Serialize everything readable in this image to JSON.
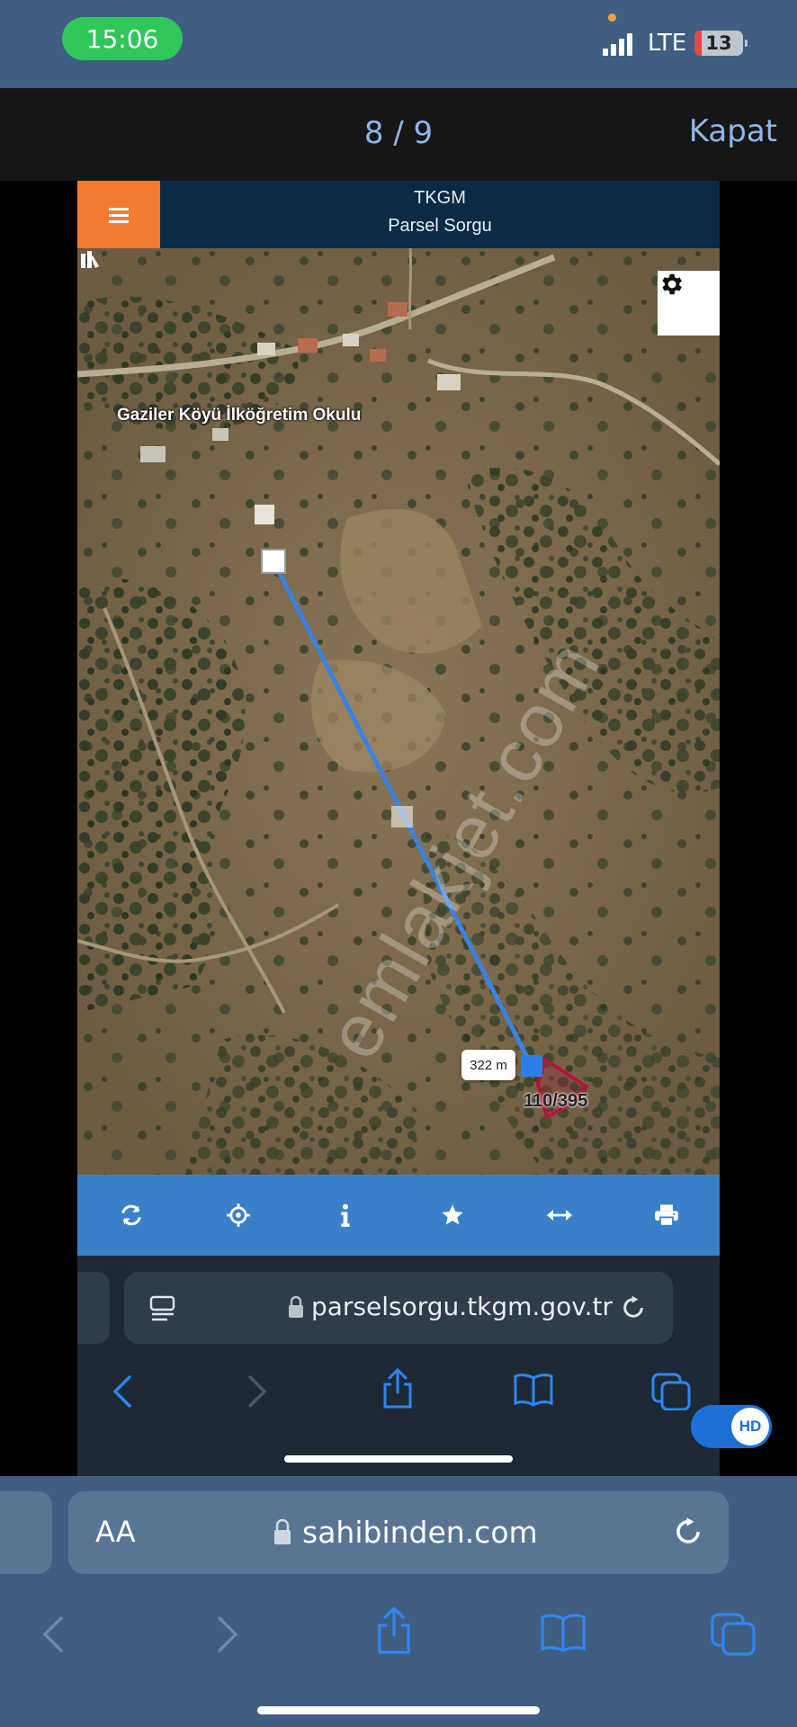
{
  "status_bar": {
    "time": "15:06",
    "network": "LTE",
    "battery": "13"
  },
  "viewer": {
    "counter": "8 / 9",
    "close_label": "Kapat"
  },
  "tkgm": {
    "title": "TKGM",
    "subtitle": "Parsel Sorgu",
    "map": {
      "poi_label": "Gaziler Köyü İlköğretim Okulu",
      "distance_label": "322 m",
      "parcel_label": "110/395",
      "watermark": "emlakjet.com"
    },
    "toolbar_icons": [
      "refresh-icon",
      "locate-icon",
      "info-icon",
      "star-icon",
      "measure-icon",
      "print-icon"
    ],
    "browser_url": "parselsorgu.tkgm.gov.tr",
    "hd_badge": "HD"
  },
  "outer_browser": {
    "text_size_label": "AA",
    "url": "sahibinden.com"
  },
  "colors": {
    "status_bg": "#3f5e82",
    "tkgm_header": "#0b2a45",
    "menu_orange": "#f47b32",
    "toolbar_blue": "#3a80c9",
    "measure_line": "#3b82e0",
    "parcel_outline": "#b0183a"
  }
}
